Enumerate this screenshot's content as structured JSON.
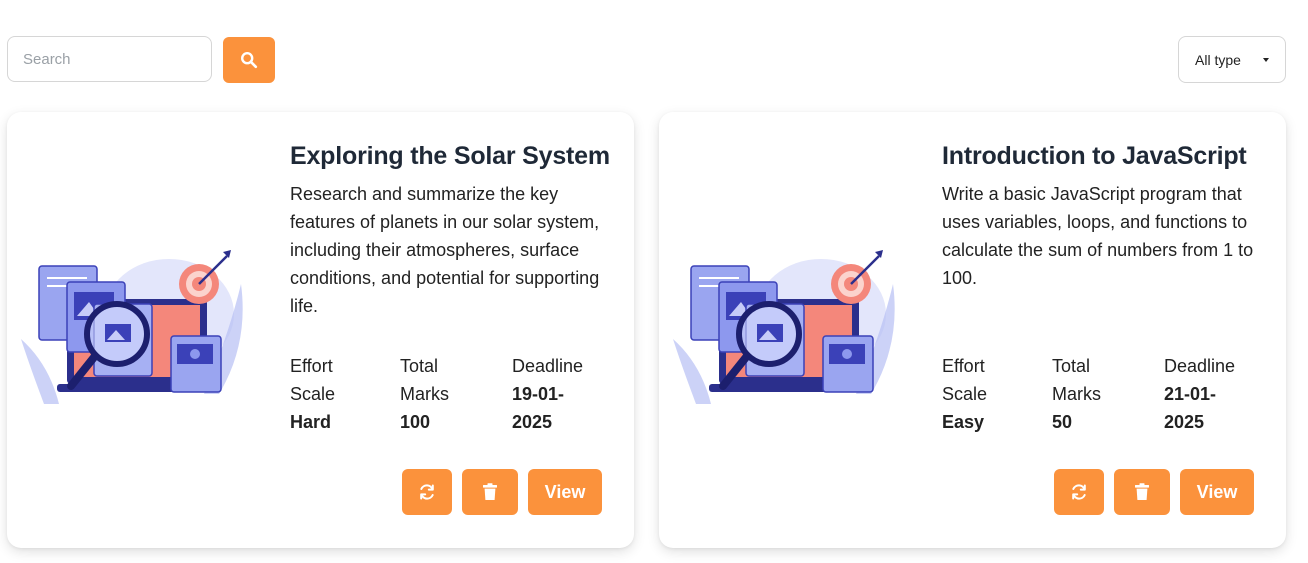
{
  "search": {
    "placeholder": "Search"
  },
  "filter": {
    "selected": "All type"
  },
  "icons": {
    "search": "search-icon",
    "refresh": "refresh-icon",
    "delete": "trash-icon",
    "caret": "caret-down-icon"
  },
  "colors": {
    "accent": "#fb923c",
    "button_text": "#ffffff"
  },
  "cards": [
    {
      "title": "Exploring the Solar System",
      "description": "Research and summarize the key features of planets in our solar system, including their atmospheres, surface conditions, and potential for supporting life.",
      "effort_label": "Effort Scale",
      "effort_value": "Hard",
      "marks_label": "Total Marks",
      "marks_value": "100",
      "deadline_label": "Deadline",
      "deadline_value": "19-01-2025",
      "view_label": "View"
    },
    {
      "title": "Introduction to JavaScript",
      "description": "Write a basic JavaScript program that uses variables, loops, and functions to calculate the sum of numbers from 1 to 100.",
      "effort_label": "Effort Scale",
      "effort_value": "Easy",
      "marks_label": "Total Marks",
      "marks_value": "50",
      "deadline_label": "Deadline",
      "deadline_value": "21-01-2025",
      "view_label": "View"
    }
  ]
}
